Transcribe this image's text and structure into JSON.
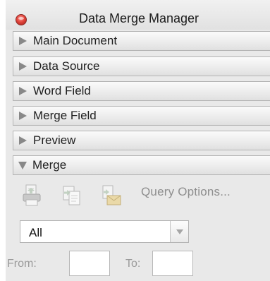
{
  "window": {
    "title": "Data Merge Manager"
  },
  "sections": [
    {
      "label": "Main Document",
      "expanded": false
    },
    {
      "label": "Data Source",
      "expanded": false
    },
    {
      "label": "Word Field",
      "expanded": false
    },
    {
      "label": "Merge Field",
      "expanded": false
    },
    {
      "label": "Preview",
      "expanded": false
    },
    {
      "label": "Merge",
      "expanded": true
    }
  ],
  "merge": {
    "toolbar": {
      "icons": [
        "merge-to-printer-icon",
        "merge-to-new-document-icon",
        "merge-to-email-icon"
      ],
      "query_options_label": "Query Options..."
    },
    "records_select": {
      "value": "All"
    },
    "range": {
      "from_label": "From:",
      "from_value": "",
      "to_label": "To:",
      "to_value": ""
    }
  },
  "colors": {
    "window_background": "#e9e9e9",
    "close_button": "#e2453c",
    "disabled_text": "#8e8e8e"
  }
}
